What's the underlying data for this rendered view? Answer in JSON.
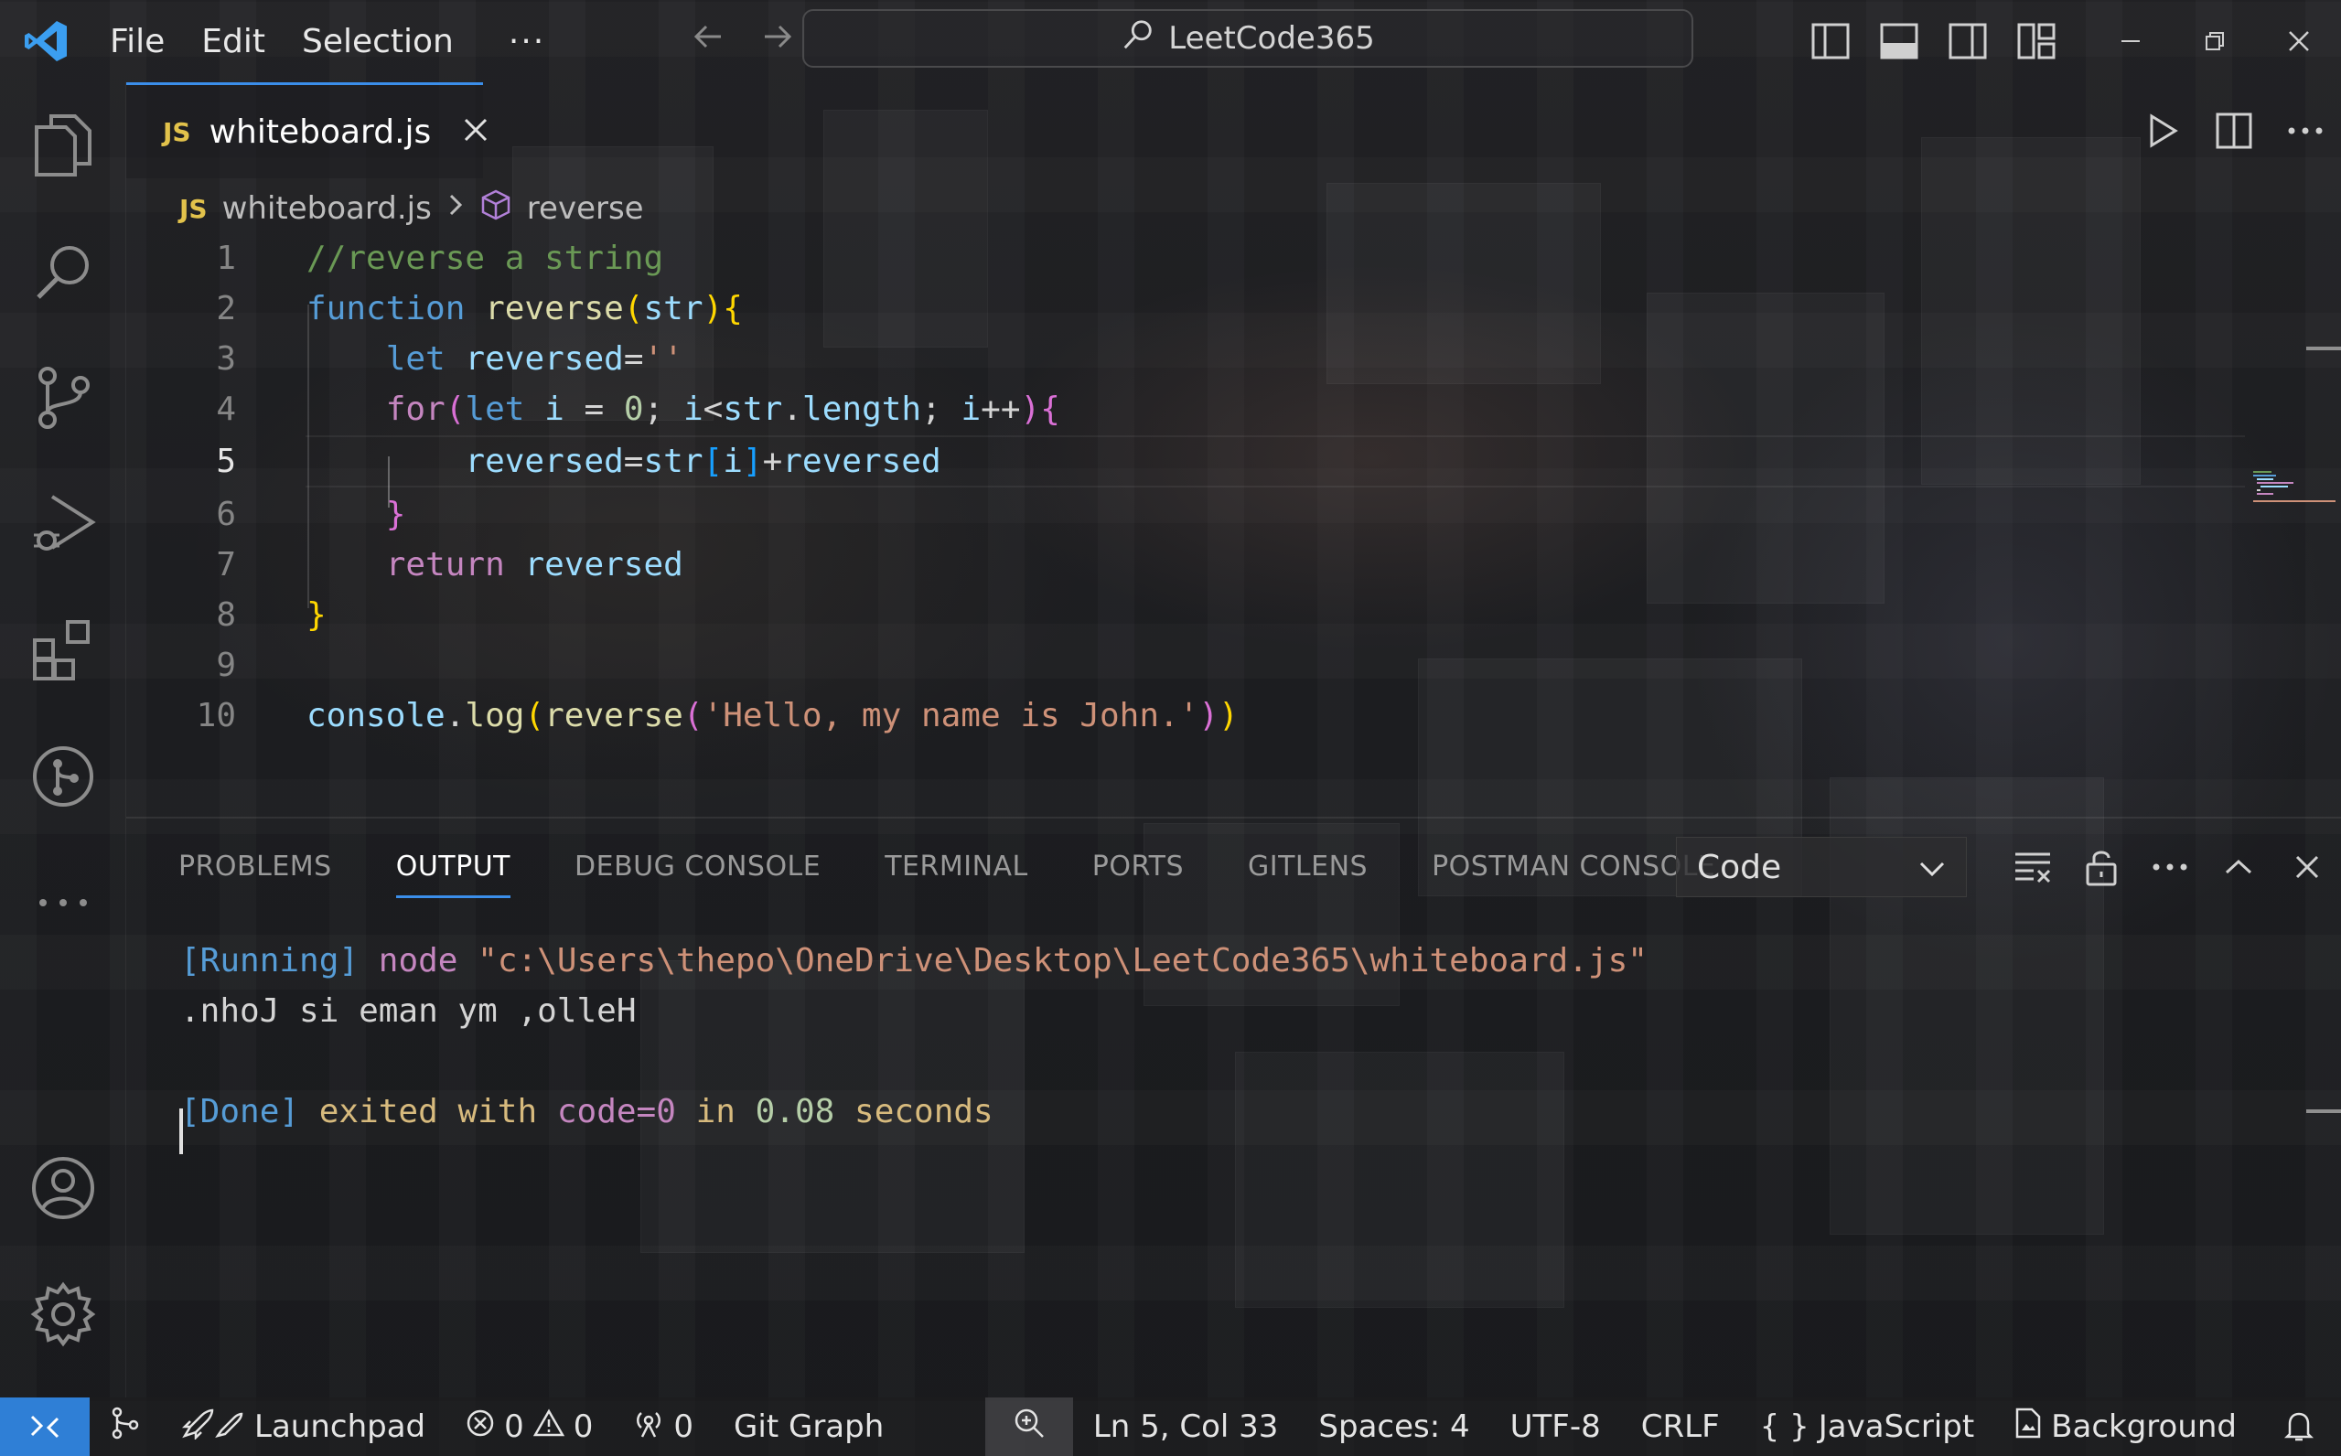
{
  "titlebar": {
    "menu": [
      "File",
      "Edit",
      "Selection"
    ],
    "more": "···",
    "search_text": "LeetCode365"
  },
  "tab": {
    "badge": "JS",
    "label": "whiteboard.js"
  },
  "breadcrumb": {
    "file": "whiteboard.js",
    "symbol": "reverse"
  },
  "editor": {
    "lines": [
      {
        "n": "1",
        "text": "//reverse a string"
      },
      {
        "n": "2",
        "text": "function reverse(str){"
      },
      {
        "n": "3",
        "text": "    let reversed=''"
      },
      {
        "n": "4",
        "text": "    for(let i = 0; i<str.length; i++){"
      },
      {
        "n": "5",
        "text": "        reversed=str[i]+reversed"
      },
      {
        "n": "6",
        "text": "    }"
      },
      {
        "n": "7",
        "text": "    return reversed"
      },
      {
        "n": "8",
        "text": "}"
      },
      {
        "n": "9",
        "text": ""
      },
      {
        "n": "10",
        "text": "console.log(reverse('Hello, my name is John.'))"
      }
    ],
    "active_line": 5
  },
  "panel": {
    "tabs": [
      "PROBLEMS",
      "OUTPUT",
      "DEBUG CONSOLE",
      "TERMINAL",
      "PORTS",
      "GITLENS",
      "POSTMAN CONSOLE"
    ],
    "active_tab": "OUTPUT",
    "channel": "Code",
    "output": {
      "running_tag": "[Running]",
      "running_cmd": "node",
      "running_path": "\"c:\\Users\\thepo\\OneDrive\\Desktop\\LeetCode365\\whiteboard.js\"",
      "result": ".nhoJ si eman ym ,olleH",
      "done_tag": "[Done]",
      "done_exited": "exited with",
      "done_code": "code=0",
      "done_in": "in",
      "done_time": "0.08",
      "done_seconds": "seconds"
    }
  },
  "statusbar": {
    "launchpad": "Launchpad",
    "errors": "0",
    "warnings": "0",
    "ports": "0",
    "git_graph": "Git Graph",
    "position": "Ln 5, Col 33",
    "spaces": "Spaces: 4",
    "encoding": "UTF-8",
    "eol": "CRLF",
    "lang_braces": "{ }",
    "language": "JavaScript",
    "background": "Background"
  },
  "colors": {
    "accent": "#3b8eea",
    "remote": "#2f7fd6",
    "js_badge": "#e2c24b"
  }
}
